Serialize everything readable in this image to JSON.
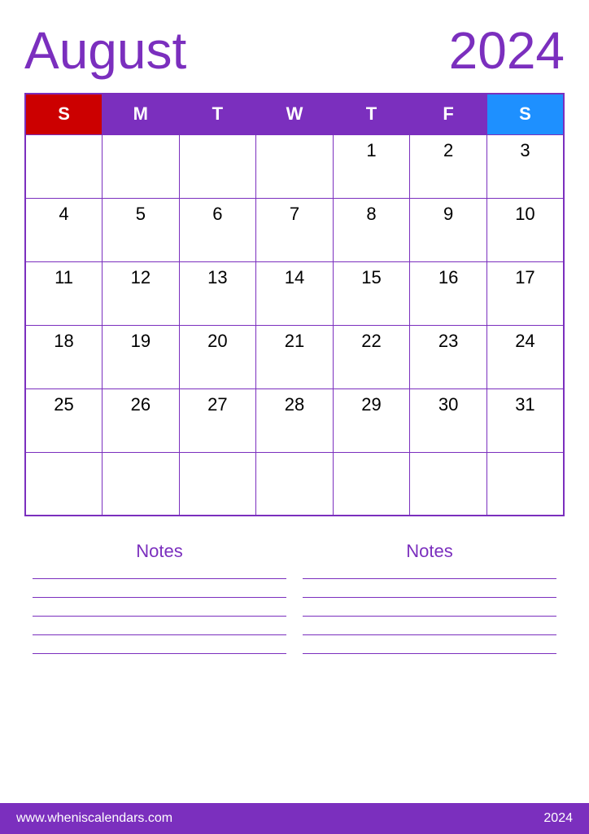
{
  "header": {
    "month": "August",
    "year": "2024"
  },
  "calendar": {
    "days_header": [
      {
        "label": "S",
        "type": "sunday"
      },
      {
        "label": "M",
        "type": "weekday"
      },
      {
        "label": "T",
        "type": "weekday"
      },
      {
        "label": "W",
        "type": "weekday"
      },
      {
        "label": "T",
        "type": "weekday"
      },
      {
        "label": "F",
        "type": "weekday"
      },
      {
        "label": "S",
        "type": "saturday"
      }
    ],
    "weeks": [
      [
        {
          "day": "",
          "type": "empty"
        },
        {
          "day": "",
          "type": "empty"
        },
        {
          "day": "",
          "type": "empty"
        },
        {
          "day": "",
          "type": "empty"
        },
        {
          "day": "1",
          "type": "normal"
        },
        {
          "day": "2",
          "type": "normal"
        },
        {
          "day": "3",
          "type": "saturday"
        }
      ],
      [
        {
          "day": "4",
          "type": "sunday"
        },
        {
          "day": "5",
          "type": "normal"
        },
        {
          "day": "6",
          "type": "normal"
        },
        {
          "day": "7",
          "type": "normal"
        },
        {
          "day": "8",
          "type": "normal"
        },
        {
          "day": "9",
          "type": "normal"
        },
        {
          "day": "10",
          "type": "saturday"
        }
      ],
      [
        {
          "day": "11",
          "type": "sunday"
        },
        {
          "day": "12",
          "type": "normal"
        },
        {
          "day": "13",
          "type": "normal"
        },
        {
          "day": "14",
          "type": "normal"
        },
        {
          "day": "15",
          "type": "normal"
        },
        {
          "day": "16",
          "type": "normal"
        },
        {
          "day": "17",
          "type": "saturday"
        }
      ],
      [
        {
          "day": "18",
          "type": "sunday"
        },
        {
          "day": "19",
          "type": "normal"
        },
        {
          "day": "20",
          "type": "normal"
        },
        {
          "day": "21",
          "type": "normal"
        },
        {
          "day": "22",
          "type": "normal"
        },
        {
          "day": "23",
          "type": "normal"
        },
        {
          "day": "24",
          "type": "saturday"
        }
      ],
      [
        {
          "day": "25",
          "type": "sunday"
        },
        {
          "day": "26",
          "type": "normal"
        },
        {
          "day": "27",
          "type": "normal"
        },
        {
          "day": "28",
          "type": "normal"
        },
        {
          "day": "29",
          "type": "normal"
        },
        {
          "day": "30",
          "type": "normal"
        },
        {
          "day": "31",
          "type": "saturday"
        }
      ],
      [
        {
          "day": "",
          "type": "empty"
        },
        {
          "day": "",
          "type": "empty"
        },
        {
          "day": "",
          "type": "empty"
        },
        {
          "day": "",
          "type": "empty"
        },
        {
          "day": "",
          "type": "empty"
        },
        {
          "day": "",
          "type": "empty"
        },
        {
          "day": "",
          "type": "empty"
        }
      ]
    ]
  },
  "notes": {
    "left_label": "Notes",
    "right_label": "Notes",
    "lines_count": 5
  },
  "footer": {
    "url": "www.wheniscalendars.com",
    "year": "2024"
  }
}
